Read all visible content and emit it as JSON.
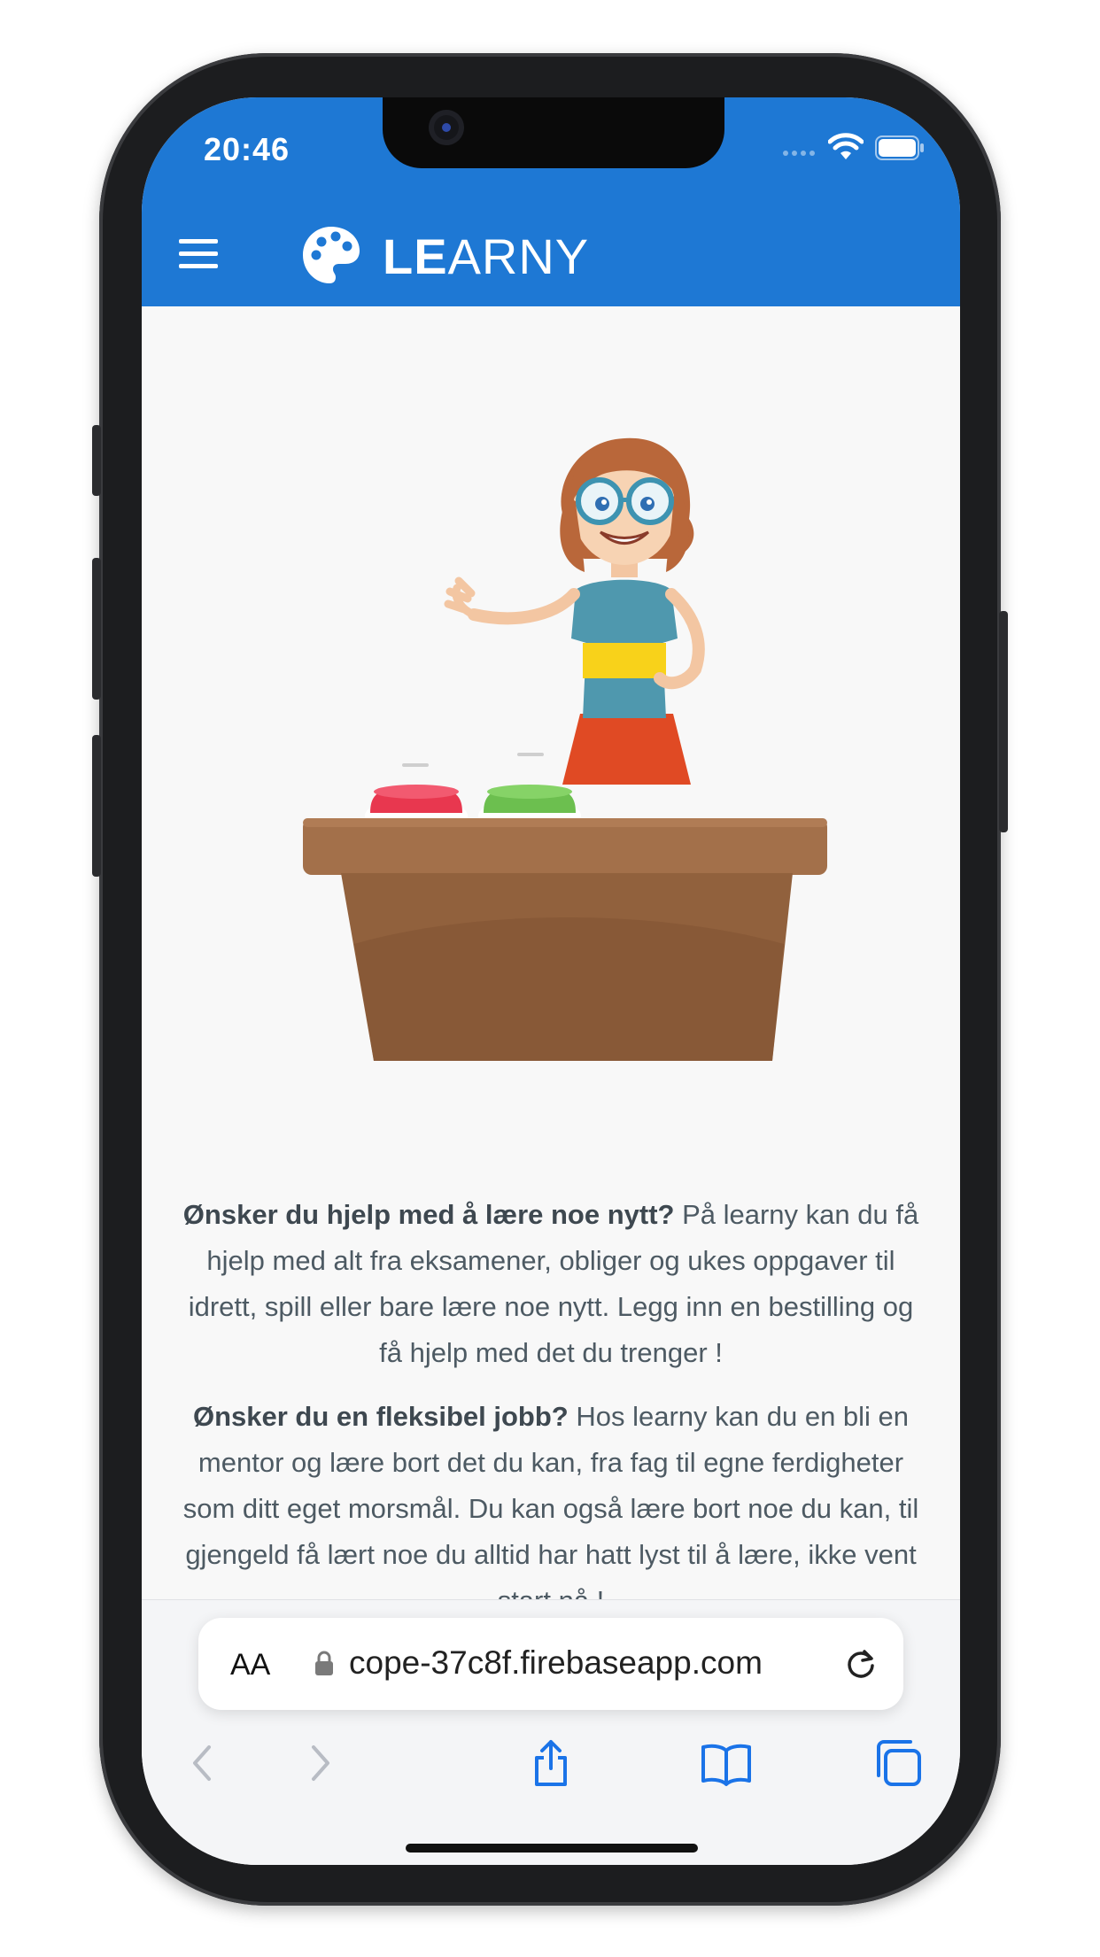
{
  "status_bar": {
    "time": "20:46"
  },
  "app_bar": {
    "brand_bold": "LE",
    "brand_rest": "ARNY"
  },
  "content": {
    "paragraph1_bold": "Ønsker du hjelp med å lære noe nytt?",
    "paragraph1_text": " På learny kan du få hjelp med alt fra eksamener, obliger og ukes oppgaver til idrett, spill eller bare lære noe nytt. Legg inn en bestilling og få hjelp med det du trenger !",
    "paragraph2_bold": "Ønsker du en fleksibel jobb?",
    "paragraph2_text": " Hos learny kan du en bli en mentor og lære bort det du kan, fra fag til egne ferdigheter som ditt eget morsmål. Du kan også lære bort noe du kan, til gjengeld få lært noe du alltid har hatt lyst til å lære, ikke vent start nå !"
  },
  "browser": {
    "text_size_label": "AA",
    "url": "cope-37c8f.firebaseapp.com"
  },
  "colors": {
    "primary": "#1e78d4",
    "ios_blue": "#1a73e8",
    "text": "#4d5a63"
  },
  "icons": [
    "hamburger-icon",
    "palette-icon",
    "wifi-icon",
    "battery-icon",
    "lock-icon",
    "reload-icon",
    "back-icon",
    "forward-icon",
    "share-icon",
    "bookmarks-icon",
    "tabs-icon"
  ]
}
